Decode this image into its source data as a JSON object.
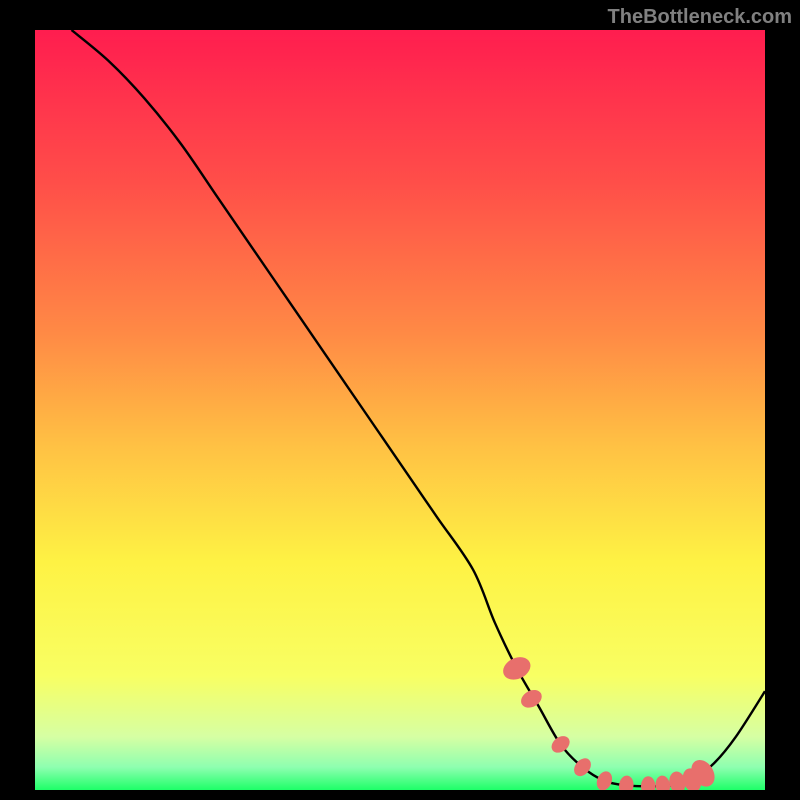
{
  "attribution": "TheBottleneck.com",
  "chart_data": {
    "type": "line",
    "title": "",
    "xlabel": "",
    "ylabel": "",
    "xlim": [
      0,
      100
    ],
    "ylim": [
      0,
      100
    ],
    "gradient_stops": [
      {
        "offset": 0,
        "color": "#ff1d4f"
      },
      {
        "offset": 20,
        "color": "#ff4e49"
      },
      {
        "offset": 40,
        "color": "#ff8a45"
      },
      {
        "offset": 55,
        "color": "#ffc244"
      },
      {
        "offset": 70,
        "color": "#fef244"
      },
      {
        "offset": 85,
        "color": "#f8ff63"
      },
      {
        "offset": 93,
        "color": "#d6ffa3"
      },
      {
        "offset": 97,
        "color": "#8effb0"
      },
      {
        "offset": 100,
        "color": "#1eff68"
      }
    ],
    "series": [
      {
        "name": "bottleneck-curve",
        "x": [
          5,
          10,
          15,
          20,
          25,
          30,
          35,
          40,
          45,
          50,
          55,
          60,
          63,
          66,
          69,
          72,
          75,
          78,
          81,
          84,
          87,
          90,
          93,
          96,
          100
        ],
        "y": [
          100,
          96,
          91,
          85,
          78,
          71,
          64,
          57,
          50,
          43,
          36,
          29,
          22,
          16,
          11,
          6,
          3,
          1.2,
          0.6,
          0.5,
          0.6,
          1.3,
          3.5,
          7,
          13
        ]
      }
    ],
    "markers": {
      "name": "highlight-beads",
      "x": [
        66,
        68,
        72,
        75,
        78,
        81,
        84,
        86,
        88,
        90,
        91.5
      ],
      "y": [
        16,
        12,
        6,
        3,
        1.2,
        0.6,
        0.5,
        0.6,
        1.0,
        1.3,
        2.2
      ],
      "scale": [
        1.3,
        1.0,
        0.9,
        0.9,
        0.9,
        0.9,
        0.9,
        0.9,
        1.0,
        1.1,
        1.3
      ],
      "color": "#e86f6c"
    }
  }
}
